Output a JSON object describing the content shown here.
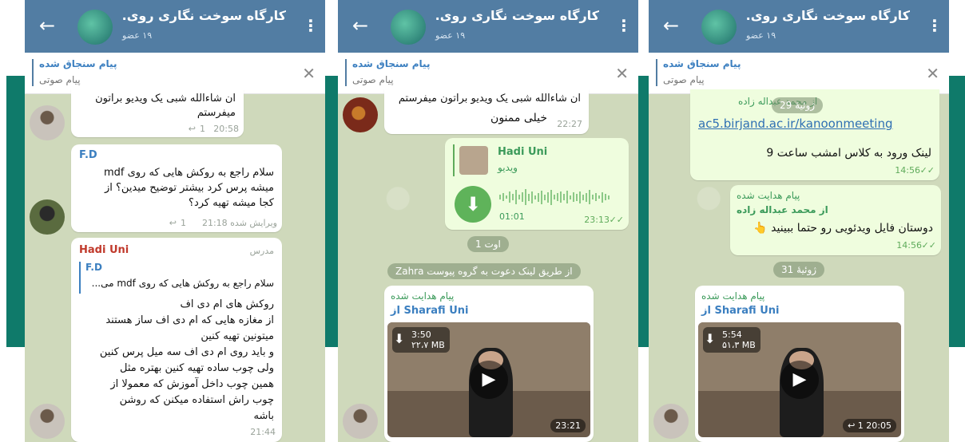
{
  "group": {
    "title": "کارگاه سوخت نگاری روی...",
    "members": "۱۹ عضو"
  },
  "pinned": {
    "title": "پیام سنجاق شده",
    "text": "پیام صوتی"
  },
  "icons": {
    "back": "back-arrow-icon",
    "menu": "more-vertical-icon",
    "close": "close-icon",
    "download": "download-icon",
    "play": "play-icon"
  },
  "panel1": {
    "m1": {
      "line1": "ان شاءالله شبی یک ویدیو براتون",
      "line2": "میفرستم",
      "time": "20:58",
      "replies": "1"
    },
    "m2": {
      "sender": "F.D",
      "line1": "سلام راجع به روکش هایی که روی mdf",
      "line2": "میشه پرس کرد بیشتر توضیح میدین؟ از",
      "line3": "کجا میشه تهیه کرد؟",
      "meta": "ویرایش شده 21:18",
      "replies": "1"
    },
    "m3": {
      "sender": "Hadi Uni",
      "role": "مدرس",
      "quote_sender": "F.D",
      "quote_text": "سلام راجع به روکش هایی که روی mdf می...",
      "lines": [
        "روکش های ام دی اف",
        "از مغازه هایی که ام دی اف ساز هستند",
        "میتونین تهیه کنین",
        "و باید روی ام دی اف سه میل پرس کنین",
        "ولی چوب ساده تهیه کنین بهتره مثل",
        "همین چوب داخل آموزش که معمولا از",
        "چوب راش استفاده میکنن که روشن",
        "باشه"
      ],
      "time": "21:44"
    }
  },
  "panel2": {
    "m1": {
      "line1": "ان شاءالله شبی یک ویدیو براتون میفرستم",
      "line2": "خیلی ممنون",
      "time": "22:27"
    },
    "voice": {
      "sender": "Hadi Uni",
      "kind": "ویدیو",
      "duration": "01:01",
      "time": "23:13"
    },
    "date": "اوت 1",
    "service": "Zahra از طریق لینک دعوت به گروه پیوست",
    "fwd": {
      "label": "پیام هدایت شده",
      "from": "از Sharafi Uni",
      "duration": "3:50",
      "size": "۲۲،۷ MB",
      "time": "23:21"
    }
  },
  "panel3": {
    "top": {
      "fwd_from": "از محمد عبداله زاده",
      "date": "ژوئیهٔ 29",
      "link": "ac5.birjand.ac.ir/kanoonmeeting",
      "text": "لینک ورود به کلاس امشب ساعت 9",
      "time": "14:56"
    },
    "m2": {
      "label": "پیام هدایت شده",
      "from": "از محمد عبداله زاده",
      "text": "دوستان فایل ویدئویی رو حتما ببینید 👆",
      "time": "14:56"
    },
    "date": "ژوئیهٔ 31",
    "fwd": {
      "label": "پیام هدایت شده",
      "from": "از Sharafi Uni",
      "duration": "5:54",
      "size": "۵۱،۳ MB",
      "time": "20:05",
      "replies": "1"
    }
  }
}
